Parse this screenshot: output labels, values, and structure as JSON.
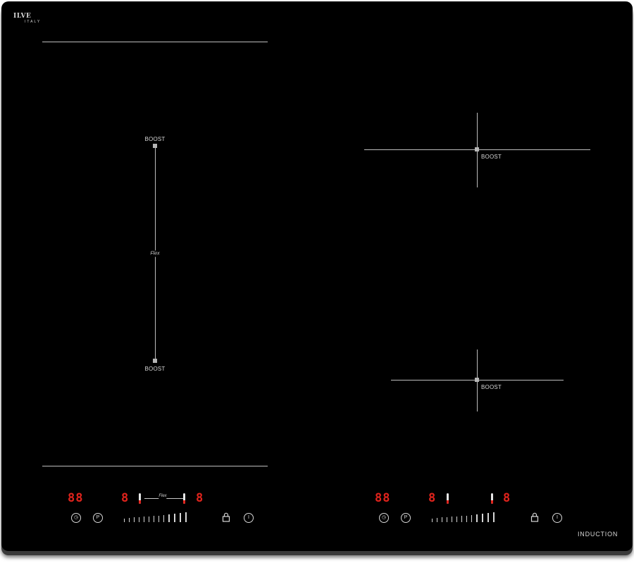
{
  "brand": {
    "name": "ILVE",
    "origin": "ITALY"
  },
  "zones": {
    "flex_zone": {
      "top_label": "BOOST",
      "middle_label": "Flex",
      "bottom_label": "BOOST"
    },
    "right_top": {
      "label": "BOOST"
    },
    "right_bottom": {
      "label": "BOOST"
    }
  },
  "left_controls": {
    "timer_display": "88",
    "zone_left_display": "8",
    "flex_label": "Flex",
    "zone_right_display": "8",
    "timer_button": "◷",
    "pause_button": "P",
    "power_button": "I"
  },
  "right_controls": {
    "timer_display": "88",
    "zone_left_display": "8",
    "zone_right_display": "8",
    "timer_button": "◷",
    "pause_button": "P",
    "power_button": "I"
  },
  "footer": {
    "type_label": "INDUCTION"
  },
  "colors": {
    "glass": "#000000",
    "lines": "#bdbdbd",
    "display_red": "#e0231c"
  }
}
